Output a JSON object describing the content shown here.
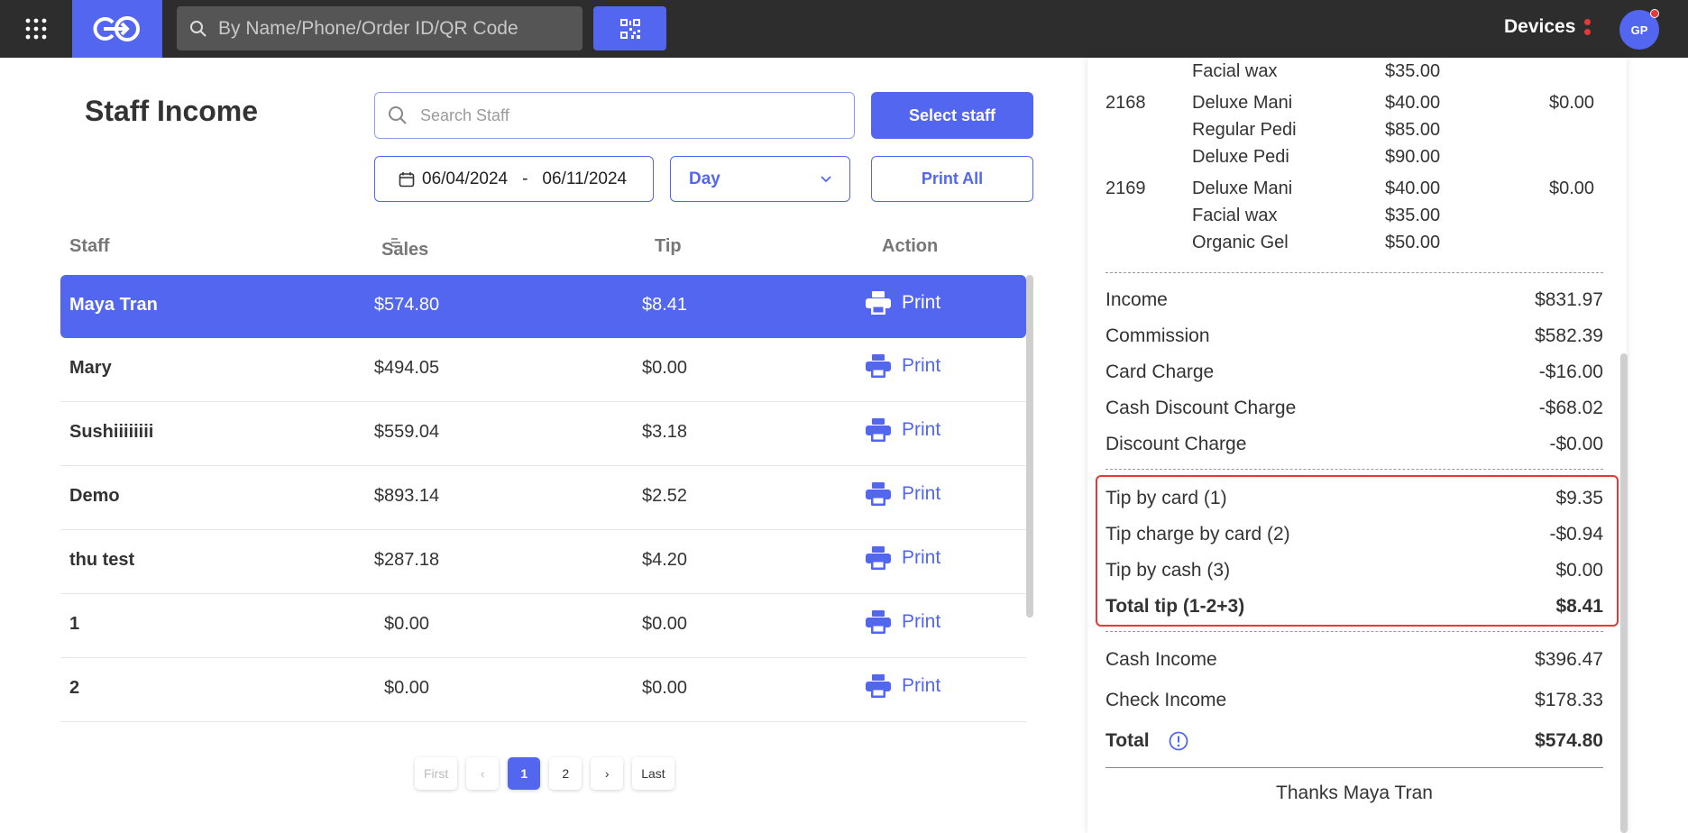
{
  "topbar": {
    "search_placeholder": "By Name/Phone/Order ID/QR Code",
    "devices_label": "Devices",
    "avatar_initials": "GP"
  },
  "page": {
    "title": "Staff Income",
    "staff_search_placeholder": "Search Staff",
    "select_staff_label": "Select staff",
    "date_from": "06/04/2024",
    "date_sep": "-",
    "date_to": "06/11/2024",
    "period": "Day",
    "print_all_label": "Print All"
  },
  "table": {
    "headers": {
      "staff": "Staff",
      "sales": "Sales",
      "tip": "Tip",
      "action": "Action"
    },
    "rows": [
      {
        "name": "Maya Tran",
        "sales": "$574.80",
        "tip": "$8.41",
        "action": "Print"
      },
      {
        "name": "Mary",
        "sales": "$494.05",
        "tip": "$0.00",
        "action": "Print"
      },
      {
        "name": "Sushiiiiiiii",
        "sales": "$559.04",
        "tip": "$3.18",
        "action": "Print"
      },
      {
        "name": "Demo",
        "sales": "$893.14",
        "tip": "$2.52",
        "action": "Print"
      },
      {
        "name": "thu test",
        "sales": "$287.18",
        "tip": "$4.20",
        "action": "Print"
      },
      {
        "name": "1",
        "sales": "$0.00",
        "tip": "$0.00",
        "action": "Print"
      },
      {
        "name": "2",
        "sales": "$0.00",
        "tip": "$0.00",
        "action": "Print"
      }
    ]
  },
  "pagination": {
    "first": "First",
    "prev": "‹",
    "pages": [
      "1",
      "2"
    ],
    "current": "1",
    "next": "›",
    "last": "Last"
  },
  "receipt": {
    "orders": [
      {
        "id": "",
        "items": [
          {
            "name": "Facial wax",
            "price": "$35.00"
          }
        ],
        "tip": ""
      },
      {
        "id": "2168",
        "items": [
          {
            "name": "Deluxe Mani",
            "price": "$40.00"
          },
          {
            "name": "Regular Pedi",
            "price": "$85.00"
          },
          {
            "name": "Deluxe Pedi",
            "price": "$90.00"
          }
        ],
        "tip": "$0.00"
      },
      {
        "id": "2169",
        "items": [
          {
            "name": "Deluxe Mani",
            "price": "$40.00"
          },
          {
            "name": "Facial wax",
            "price": "$35.00"
          },
          {
            "name": "Organic Gel",
            "price": "$50.00"
          }
        ],
        "tip": "$0.00"
      }
    ],
    "summary": [
      {
        "label": "Income",
        "value": "$831.97"
      },
      {
        "label": "Commission",
        "value": "$582.39"
      },
      {
        "label": "Card Charge",
        "value": "-$16.00"
      },
      {
        "label": "Cash Discount Charge",
        "value": "-$68.02"
      },
      {
        "label": "Discount Charge",
        "value": "-$0.00"
      }
    ],
    "tips": [
      {
        "label": "Tip by card (1)",
        "value": "$9.35"
      },
      {
        "label": "Tip charge by card (2)",
        "value": "-$0.94"
      },
      {
        "label": "Tip by cash (3)",
        "value": "$0.00"
      },
      {
        "label": "Total tip (1-2+3)",
        "value": "$8.41"
      }
    ],
    "cash_income": {
      "label": "Cash Income",
      "value": "$396.47"
    },
    "check_income": {
      "label": "Check Income",
      "value": "$178.33"
    },
    "total": {
      "label": "Total",
      "value": "$574.80"
    },
    "thanks": "Thanks Maya Tran"
  },
  "colors": {
    "accent": "#5266f0",
    "topbar": "#2d2d2d",
    "highlight_border": "#e53935"
  }
}
